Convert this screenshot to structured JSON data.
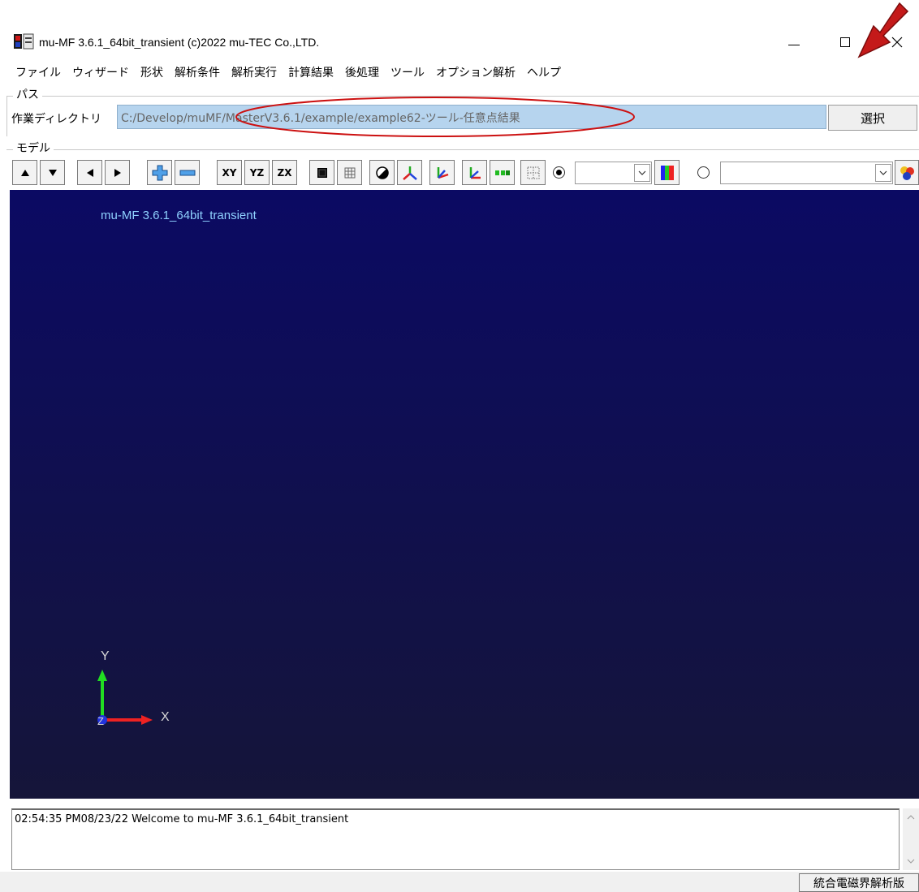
{
  "window": {
    "title": "mu-MF 3.6.1_64bit_transient (c)2022 mu-TEC Co.,LTD.",
    "minimize_glyph": "—",
    "maximize_glyph": "☐",
    "close_glyph": "✕"
  },
  "menu": {
    "items": [
      "ファイル",
      "ウィザード",
      "形状",
      "解析条件",
      "解析実行",
      "計算結果",
      "後処理",
      "ツール",
      "オプション解析",
      "ヘルプ"
    ]
  },
  "path_group": {
    "label": "パス",
    "dir_label": "作業ディレクトリ",
    "dir_value": "C:/Develop/muMF/MasterV3.6.1/example/example62-ツール-任意点結果",
    "select_button": "選択"
  },
  "model_group": {
    "label": "モデル",
    "toolbar": {
      "xy": "XY",
      "yz": "YZ",
      "zx": "ZX"
    }
  },
  "viewport": {
    "label": "mu-MF 3.6.1_64bit_transient",
    "axis_x": "X",
    "axis_y": "Y",
    "axis_z": "Z"
  },
  "log": {
    "line": "02:54:35 PM08/23/22 Welcome to mu-MF 3.6.1_64bit_transient"
  },
  "status": {
    "edition": "統合電磁界解析版"
  },
  "colors": {
    "annotation_red": "#cc1111",
    "path_highlight": "#b6d4ee",
    "viewport_top": "#0b0a63",
    "viewport_bottom": "#151539"
  }
}
